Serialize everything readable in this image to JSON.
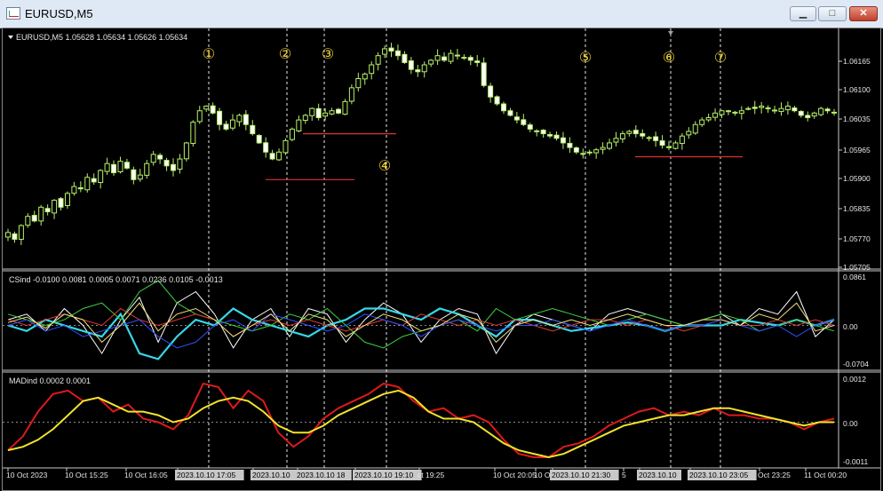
{
  "window": {
    "title": "EURUSD,M5",
    "min_label": "▁",
    "max_label": "□",
    "close_label": "✕"
  },
  "price_pane": {
    "header": "EURUSD,M5  1.05628 1.05634 1.05626 1.05634"
  },
  "cs_pane": {
    "header": "CSind -0.0100 0.0081 0.0005 0.0071 0.0236 0.0105 -0.0013"
  },
  "mad_pane": {
    "header": "MADind 0.0002 0.0001"
  },
  "markers": [
    "①",
    "②",
    "③",
    "④",
    "⑤",
    "⑥",
    "⑦"
  ],
  "chart_data": [
    {
      "type": "candlestick",
      "title": "EURUSD,M5",
      "ohlc_shown": [
        1.05628,
        1.05634,
        1.05626,
        1.05634
      ],
      "y_ticks": [
        "1.06165",
        "1.06100",
        "1.06035",
        "1.05965",
        "1.05900",
        "1.05835",
        "1.05770",
        "1.05705"
      ],
      "ylim": [
        1.05705,
        1.062
      ],
      "close_path": [
        1.05775,
        1.0576,
        1.0579,
        1.0581,
        1.058,
        1.0583,
        1.0582,
        1.05845,
        1.0583,
        1.0586,
        1.05875,
        1.0587,
        1.05895,
        1.05885,
        1.0591,
        1.05925,
        1.05905,
        1.0593,
        1.05915,
        1.0589,
        1.059,
        1.05925,
        1.05945,
        1.05935,
        1.0592,
        1.0591,
        1.05935,
        1.0597,
        1.06015,
        1.0604,
        1.0605,
        1.06035,
        1.0601,
        1.06,
        1.0602,
        1.0603,
        1.0601,
        1.0599,
        1.0597,
        1.0595,
        1.05935,
        1.0595,
        1.05975,
        1.06,
        1.0602,
        1.0603,
        1.06045,
        1.06025,
        1.06035,
        1.0604,
        1.06035,
        1.0606,
        1.0609,
        1.0611,
        1.0612,
        1.0614,
        1.0616,
        1.06175,
        1.0617,
        1.0616,
        1.06145,
        1.0613,
        1.06125,
        1.0614,
        1.0615,
        1.0616,
        1.0615,
        1.06165,
        1.0616,
        1.06155,
        1.0615,
        1.06145,
        1.06095,
        1.0607,
        1.06055,
        1.0604,
        1.0603,
        1.0602,
        1.0601,
        1.06,
        1.05995,
        1.0599,
        1.05985,
        1.0598,
        1.0597,
        1.0596,
        1.0595,
        1.05945,
        1.0595,
        1.05955,
        1.0596,
        1.0597,
        1.0598,
        1.0599,
        1.05995,
        1.0599,
        1.05985,
        1.0598,
        1.05975,
        1.05965,
        1.0596,
        1.0597,
        1.05985,
        1.05995,
        1.0601,
        1.0602,
        1.06025,
        1.06035,
        1.0604,
        1.0604,
        1.06035,
        1.0604,
        1.06045,
        1.06045,
        1.0605,
        1.06045,
        1.0604,
        1.06045,
        1.0605,
        1.0604,
        1.0603,
        1.06025,
        1.06035,
        1.06045,
        1.0604,
        1.06035
      ],
      "lines": [
        {
          "name": "support-2",
          "y": 1.0589
        },
        {
          "name": "support-3-4",
          "y": 1.0599
        },
        {
          "name": "support-6",
          "y": 1.0594
        }
      ]
    },
    {
      "type": "line",
      "title": "CSind",
      "header_values": [
        -0.01,
        0.0081,
        0.0005,
        0.0071,
        0.0236,
        0.0105,
        -0.0013
      ],
      "y_ticks": [
        "0.0861",
        "0.00",
        "-0.0704"
      ],
      "ylim": [
        -0.0704,
        0.0861
      ],
      "series": [
        {
          "color": "#ffffff",
          "values": [
            0.01,
            0.02,
            -0.01,
            0.03,
            0.0,
            -0.05,
            0.01,
            0.05,
            -0.03,
            0.04,
            0.06,
            0.02,
            -0.04,
            0.01,
            0.03,
            -0.02,
            0.03,
            0.02,
            -0.03,
            0.01,
            0.04,
            0.02,
            -0.03,
            0.01,
            0.03,
            0.02,
            -0.05,
            0.0,
            0.02,
            0.01,
            0.0,
            -0.01,
            0.02,
            0.03,
            0.02,
            0.01,
            0.0,
            0.01,
            0.02,
            0.0,
            0.03,
            0.02,
            0.06,
            -0.02,
            0.01
          ]
        },
        {
          "color": "#36d7e8",
          "values": [
            0.0,
            -0.01,
            0.01,
            0.0,
            -0.01,
            -0.02,
            0.02,
            -0.05,
            -0.06,
            -0.02,
            0.01,
            0.0,
            0.03,
            0.01,
            0.0,
            -0.01,
            -0.02,
            0.0,
            0.01,
            0.03,
            0.03,
            0.02,
            0.01,
            0.03,
            0.02,
            0.0,
            -0.02,
            0.01,
            0.01,
            0.0,
            -0.01,
            -0.005,
            0.0,
            0.005,
            0.0,
            -0.01,
            0.0,
            0.0,
            0.0,
            0.01,
            0.005,
            0.0,
            0.01,
            0.0,
            0.01
          ]
        },
        {
          "color": "#40d040",
          "values": [
            0.02,
            0.01,
            0.0,
            0.01,
            0.03,
            0.04,
            0.01,
            0.06,
            0.08,
            0.04,
            0.02,
            0.01,
            0.0,
            -0.01,
            0.0,
            0.02,
            0.01,
            0.03,
            0.0,
            -0.03,
            -0.04,
            -0.02,
            -0.01,
            0.0,
            0.01,
            -0.01,
            0.03,
            0.01,
            0.02,
            0.03,
            0.02,
            0.01,
            0.0,
            0.01,
            0.02,
            0.01,
            0.0,
            0.01,
            0.02,
            0.01,
            -0.01,
            0.0,
            0.01,
            0.0,
            -0.01
          ]
        },
        {
          "color": "#e03a3a",
          "values": [
            0.01,
            0.0,
            0.01,
            0.02,
            0.01,
            0.0,
            0.03,
            0.01,
            0.0,
            0.01,
            0.02,
            0.01,
            -0.02,
            0.0,
            0.01,
            0.0,
            0.01,
            0.0,
            -0.01,
            0.0,
            0.01,
            0.0,
            0.02,
            0.01,
            0.0,
            0.01,
            0.0,
            0.01,
            0.0,
            -0.01,
            0.0,
            0.01,
            0.01,
            0.0,
            0.01,
            0.0,
            -0.01,
            0.0,
            0.01,
            0.0,
            0.0,
            0.01,
            0.0,
            0.01,
            0.0
          ]
        },
        {
          "color": "#3050ff",
          "values": [
            0.0,
            0.01,
            -0.01,
            0.0,
            -0.02,
            -0.01,
            0.0,
            0.01,
            -0.02,
            -0.04,
            -0.03,
            0.0,
            0.01,
            -0.01,
            0.02,
            0.01,
            0.0,
            -0.01,
            0.0,
            0.02,
            0.01,
            0.0,
            -0.02,
            0.0,
            0.01,
            0.0,
            -0.01,
            0.0,
            0.0,
            0.01,
            0.0,
            -0.01,
            0.0,
            0.01,
            0.0,
            -0.01,
            0.0,
            0.0,
            0.01,
            0.0,
            -0.01,
            0.0,
            -0.02,
            0.0,
            0.01
          ]
        },
        {
          "color": "#f2e07a",
          "values": [
            0.005,
            0.015,
            -0.005,
            0.02,
            0.01,
            -0.03,
            0.0,
            0.04,
            -0.01,
            0.02,
            0.03,
            0.01,
            -0.02,
            0.0,
            0.02,
            -0.01,
            0.02,
            0.01,
            -0.02,
            0.0,
            0.02,
            0.01,
            -0.01,
            0.0,
            0.02,
            0.01,
            -0.03,
            0.0,
            0.01,
            0.0,
            0.01,
            0.0,
            0.01,
            0.02,
            0.01,
            0.0,
            0.0,
            0.01,
            0.01,
            0.0,
            0.02,
            0.01,
            0.04,
            -0.01,
            0.0
          ]
        }
      ]
    },
    {
      "type": "line",
      "title": "MADind",
      "header_values": [
        0.0002,
        0.0001
      ],
      "y_ticks": [
        "0.0012",
        "0.00",
        "-0.0011"
      ],
      "ylim": [
        -0.0011,
        0.0012
      ],
      "series": [
        {
          "color": "#dd1a1a",
          "values": [
            -0.0008,
            -0.0004,
            0.0003,
            0.0008,
            0.0009,
            0.0006,
            0.0007,
            0.0003,
            0.0005,
            0.0001,
            0.0,
            -0.0002,
            0.0002,
            0.0011,
            0.001,
            0.0004,
            0.0009,
            0.0006,
            -0.0003,
            -0.0007,
            -0.0004,
            0.0001,
            0.0004,
            0.0006,
            0.0008,
            0.0011,
            0.001,
            0.0006,
            0.0003,
            0.0004,
            0.0001,
            0.0002,
            0.0,
            -0.0005,
            -0.0009,
            -0.001,
            -0.001,
            -0.0007,
            -0.0006,
            -0.0004,
            -0.0001,
            0.0001,
            0.0003,
            0.0004,
            0.0002,
            0.0003,
            0.0002,
            0.0004,
            0.0002,
            0.0002,
            0.0001,
            0.0001,
            0.0,
            -0.0002,
            0.0,
            0.0001
          ]
        },
        {
          "color": "#f1e32b",
          "values": [
            -0.0008,
            -0.0007,
            -0.0005,
            -0.0002,
            0.0002,
            0.0006,
            0.0007,
            0.0005,
            0.0003,
            0.0003,
            0.0002,
            0.0,
            0.0001,
            0.0004,
            0.0006,
            0.0007,
            0.0006,
            0.0003,
            -0.0001,
            -0.0003,
            -0.0003,
            -0.0001,
            0.0002,
            0.0004,
            0.0006,
            0.0008,
            0.0009,
            0.0007,
            0.0003,
            0.0001,
            0.0001,
            0.0,
            -0.0003,
            -0.0006,
            -0.0008,
            -0.0009,
            -0.001,
            -0.0009,
            -0.0007,
            -0.0005,
            -0.0003,
            -0.0001,
            0.0,
            0.0001,
            0.0002,
            0.0002,
            0.0003,
            0.0004,
            0.0004,
            0.0003,
            0.0002,
            0.0001,
            0.0,
            -0.0001,
            0.0,
            0.0
          ]
        }
      ]
    }
  ],
  "time_axis": [
    "10 Oct 2023",
    "10 Oct 15:25",
    "10 Oct 16:05",
    "2023.10.10 17:05",
    "2023.10.10",
    "2023.10.10 18",
    "2023.10.10 19:10",
    "ct 19:25",
    "10 Oct 20:05",
    "10 Oct",
    "2023.10.10 21:30",
    "5",
    "2023.10.10",
    "2023.10.10 23:05",
    "Oct 23:25",
    "11 Oct 00:20"
  ]
}
